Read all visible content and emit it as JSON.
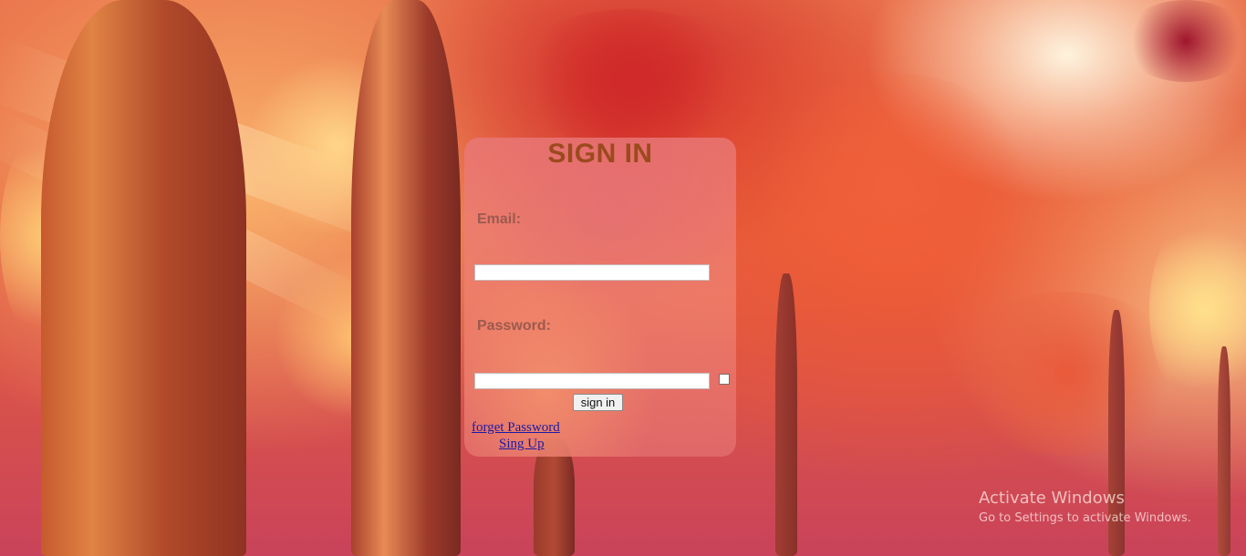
{
  "form": {
    "title": "SIGN IN",
    "email_label": "Email:",
    "email_value": "",
    "password_label": "Password:",
    "password_value": "",
    "submit_label": "sign in",
    "forgot_link": "forget Password",
    "signup_link": "Sing Up"
  },
  "watermark": {
    "title": "Activate Windows",
    "subtitle": "Go to Settings to activate Windows."
  },
  "colors": {
    "title": "#9b4a1d",
    "labels": "#9c5a4f",
    "links": "#1a1aa6",
    "panel": "#e9787a"
  }
}
